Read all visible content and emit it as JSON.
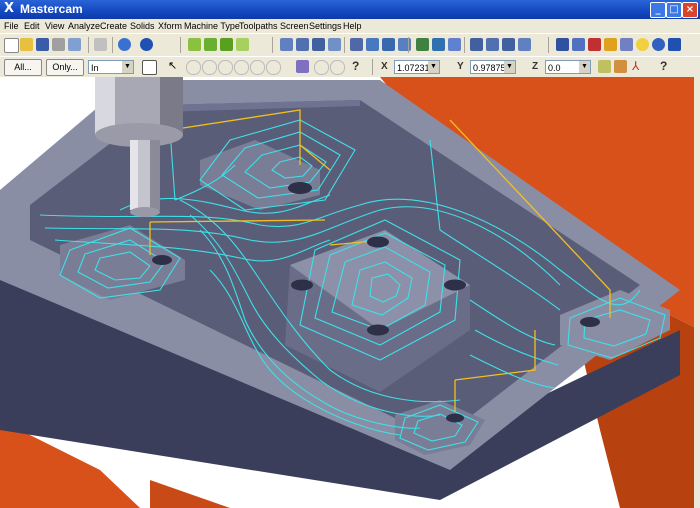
{
  "window": {
    "title": "Mastercam",
    "app_icon": "mastercam-x-icon"
  },
  "menu": [
    "File",
    "Edit",
    "View",
    "Analyze",
    "Create",
    "Solids",
    "Xform",
    "Machine Type",
    "Toolpaths",
    "Screen",
    "Settings",
    "Help"
  ],
  "toolbar2": {
    "all_label": "All...",
    "only_label": "Only...",
    "level_value": "In",
    "x_label": "X",
    "x_value": "1.07231",
    "y_label": "Y",
    "y_value": "0.97875",
    "z_label": "Z",
    "z_value": "0.0"
  },
  "colors": {
    "title_bar": "#1348c0",
    "toolpath": "#3ee0e8",
    "rapid_move": "#f0c020",
    "stock": "#888ca0",
    "fixture": "#d8501a"
  },
  "icons": [
    "new-file-icon",
    "open-icon",
    "save-icon",
    "print-icon",
    "zoom-icon",
    "screen-views-icon",
    "shading-icon",
    "toolpaths-icon",
    "help-icon"
  ]
}
